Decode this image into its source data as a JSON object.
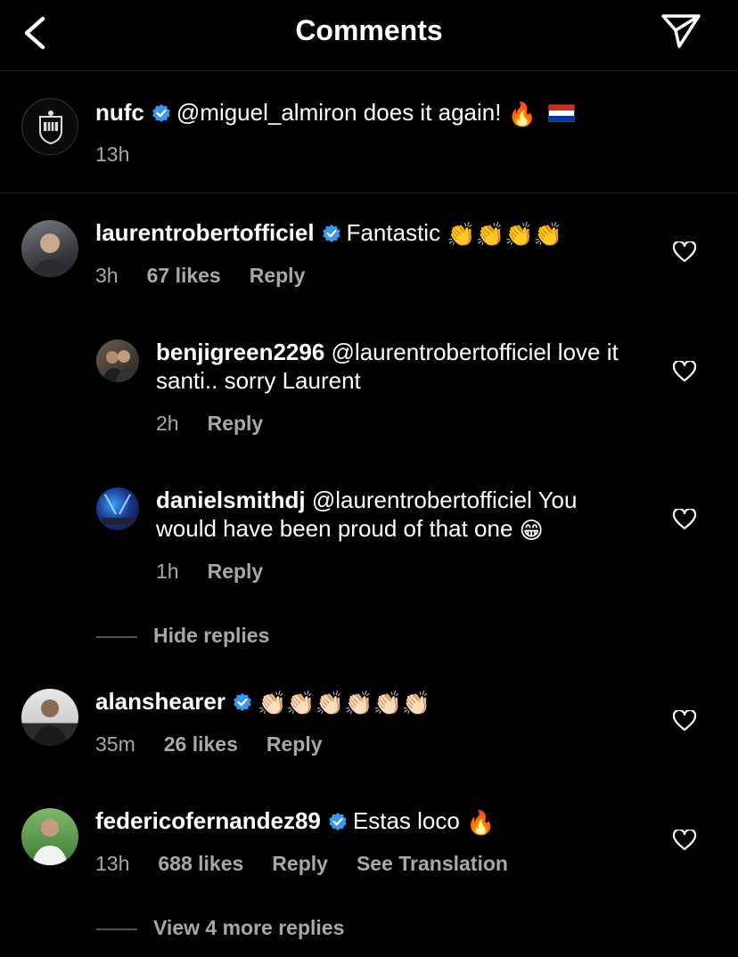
{
  "header": {
    "title": "Comments"
  },
  "caption": {
    "username": "nufc",
    "text": "@miguel_almiron does it again!",
    "emoji_fire": "🔥",
    "time": "13h"
  },
  "comments": [
    {
      "username": "laurentrobertofficiel",
      "verified": true,
      "text": "Fantastic",
      "emojis": "👏👏👏👏",
      "time": "3h",
      "likes": "67 likes",
      "reply": "Reply",
      "replies": [
        {
          "username": "benjigreen2296",
          "text": "@laurentrobertofficiel love it santi.. sorry Laurent",
          "time": "2h",
          "reply": "Reply"
        },
        {
          "username": "danielsmithdj",
          "text": "@laurentrobertofficiel You would have been proud of that one",
          "emoji": "😁",
          "time": "1h",
          "reply": "Reply"
        }
      ],
      "toggle": "Hide replies"
    },
    {
      "username": "alanshearer",
      "verified": true,
      "emojis": "👏🏻👏🏻👏🏻👏🏻👏🏻👏🏻",
      "time": "35m",
      "likes": "26 likes",
      "reply": "Reply"
    },
    {
      "username": "federicofernandez89",
      "verified": true,
      "text": "Estas loco",
      "emoji": "🔥",
      "time": "13h",
      "likes": "688 likes",
      "reply": "Reply",
      "translation": "See Translation",
      "toggle": "View 4 more replies"
    }
  ],
  "colors": {
    "background": "#000000",
    "verified": "#3897f0",
    "muted": "#a8a8a8"
  },
  "icons": [
    "back-chevron-icon",
    "send-icon",
    "verified-icon",
    "heart-icon"
  ]
}
